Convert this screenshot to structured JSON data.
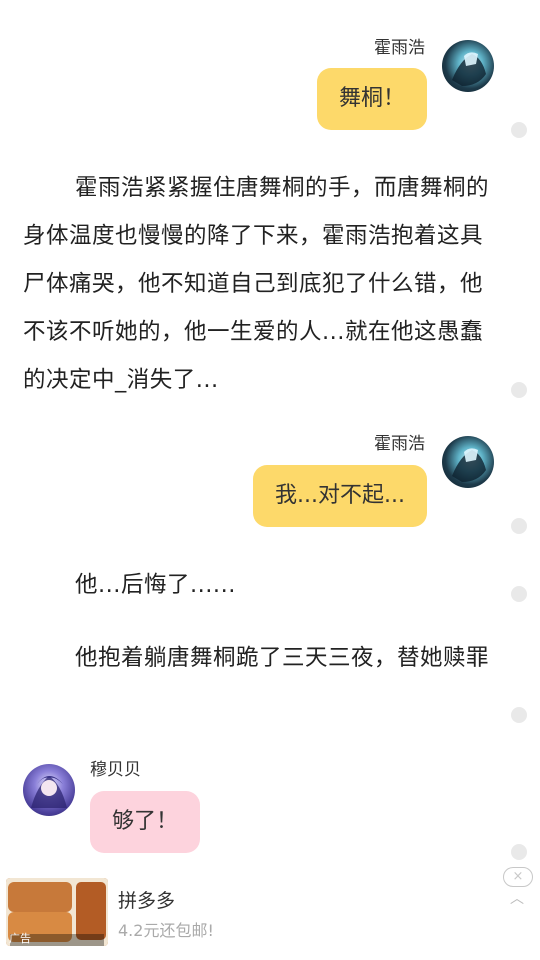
{
  "messages": [
    {
      "speaker": "霍雨浩",
      "text": "舞桐！"
    },
    {
      "speaker": "霍雨浩",
      "text": "我...对不起..."
    },
    {
      "speaker": "穆贝贝",
      "text": "够了！"
    }
  ],
  "narrations": [
    "霍雨浩紧紧握住唐舞桐的手，而唐舞桐的身体温度也慢慢的降了下来，霍雨浩抱着这具尸体痛哭，他不知道自己到底犯了什么错，他不该不听她的，他一生爱的人...就在他这愚蠢的决定中_消失了...",
    "他...后悔了......",
    "他抱着躺唐舞桐跪了三天三夜，替她赎罪"
  ],
  "ad": {
    "title": "拼多多",
    "subtitle": "4.2元还包邮!",
    "tag": "广告",
    "close_icon": "×",
    "chevron_icon": "︿"
  },
  "colors": {
    "bubble_yellow": "#fdd96a",
    "bubble_pink": "#fdd3dd",
    "dot": "#e9e9e9"
  }
}
